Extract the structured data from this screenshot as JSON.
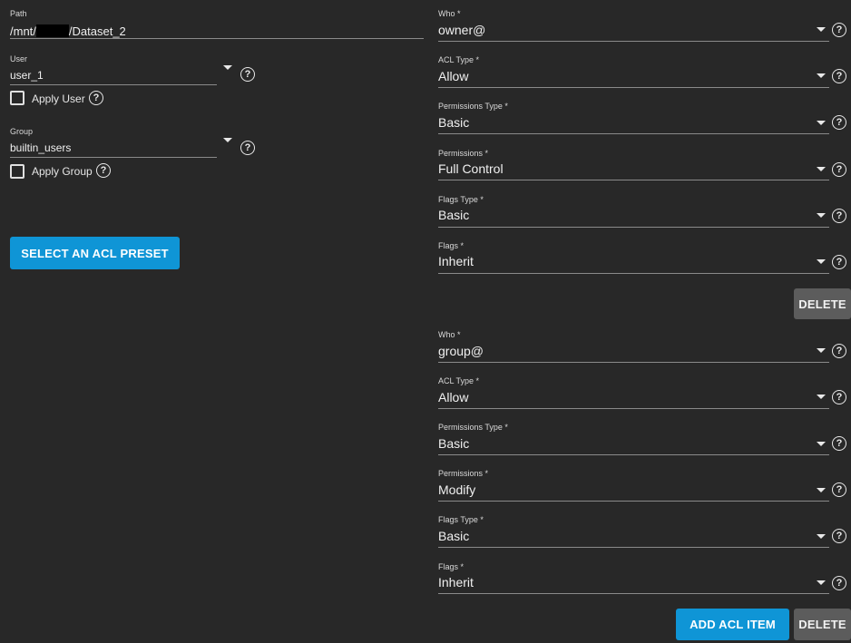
{
  "left": {
    "path": {
      "label": "Path",
      "prefix": "/mnt/",
      "suffix": "/Dataset_2"
    },
    "user": {
      "label": "User",
      "value": "user_1",
      "apply_label": "Apply User"
    },
    "group": {
      "label": "Group",
      "value": "builtin_users",
      "apply_label": "Apply Group"
    },
    "preset_button": "SELECT AN ACL PRESET"
  },
  "acl_items": [
    {
      "who": {
        "label": "Who *",
        "value": "owner@"
      },
      "acl_type": {
        "label": "ACL Type *",
        "value": "Allow"
      },
      "permissions_type": {
        "label": "Permissions Type *",
        "value": "Basic"
      },
      "permissions": {
        "label": "Permissions *",
        "value": "Full Control"
      },
      "flags_type": {
        "label": "Flags Type *",
        "value": "Basic"
      },
      "flags": {
        "label": "Flags *",
        "value": "Inherit"
      },
      "delete_label": "DELETE"
    },
    {
      "who": {
        "label": "Who *",
        "value": "group@"
      },
      "acl_type": {
        "label": "ACL Type *",
        "value": "Allow"
      },
      "permissions_type": {
        "label": "Permissions Type *",
        "value": "Basic"
      },
      "permissions": {
        "label": "Permissions *",
        "value": "Modify"
      },
      "flags_type": {
        "label": "Flags Type *",
        "value": "Basic"
      },
      "flags": {
        "label": "Flags *",
        "value": "Inherit"
      },
      "delete_label": "DELETE"
    }
  ],
  "add_acl_item": "ADD ACL ITEM",
  "help_glyph": "?",
  "icons": [
    "dropdown-caret-icon",
    "help-circle-icon",
    "checkbox-icon"
  ]
}
